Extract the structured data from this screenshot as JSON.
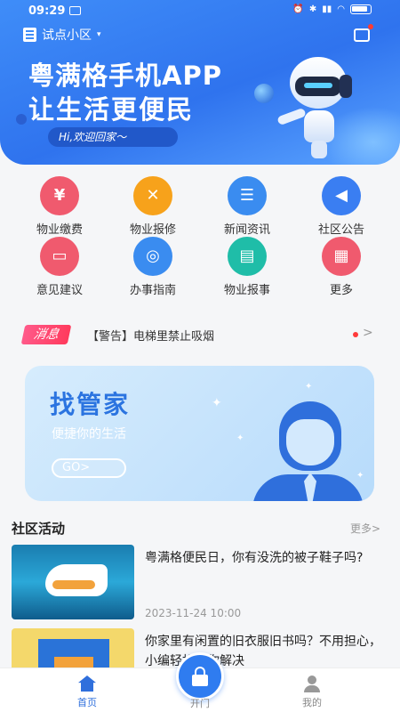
{
  "status_bar": {
    "time": "09:29"
  },
  "header": {
    "location": "试点小区",
    "headline_1": "粤满格手机APP",
    "headline_2": "让生活更便民",
    "welcome": "Hi,欢迎回家～"
  },
  "quick_grid": [
    {
      "label": "物业缴费",
      "icon": "wallet-icon",
      "color": "#f05a6e"
    },
    {
      "label": "物业报修",
      "icon": "tools-icon",
      "color": "#f7a21b"
    },
    {
      "label": "新闻资讯",
      "icon": "newspaper-icon",
      "color": "#3a8cf0"
    },
    {
      "label": "社区公告",
      "icon": "megaphone-icon",
      "color": "#3a7ef2"
    },
    {
      "label": "意见建议",
      "icon": "comment-icon",
      "color": "#f05a6e"
    },
    {
      "label": "办事指南",
      "icon": "compass-icon",
      "color": "#3a8cf0"
    },
    {
      "label": "物业报事",
      "icon": "printer-icon",
      "color": "#1fbda8"
    },
    {
      "label": "更多",
      "icon": "grid-icon",
      "color": "#f05a6e"
    }
  ],
  "notice": {
    "tag": "消息",
    "text": "【警告】电梯里禁止吸烟"
  },
  "butler": {
    "title": "找管家",
    "subtitle": "便捷你的生活",
    "button": "GO>"
  },
  "community": {
    "title": "社区活动",
    "more": "更多>",
    "items": [
      {
        "title": "粤满格便民日，你有没洗的被子鞋子吗?",
        "date": "2023-11-24 10:00"
      },
      {
        "title": "你家里有闲置的旧衣服旧书吗？不用担心，小编轻松帮你解决",
        "date": ""
      }
    ]
  },
  "tabbar": {
    "home": "首页",
    "open": "开门",
    "mine": "我的"
  }
}
